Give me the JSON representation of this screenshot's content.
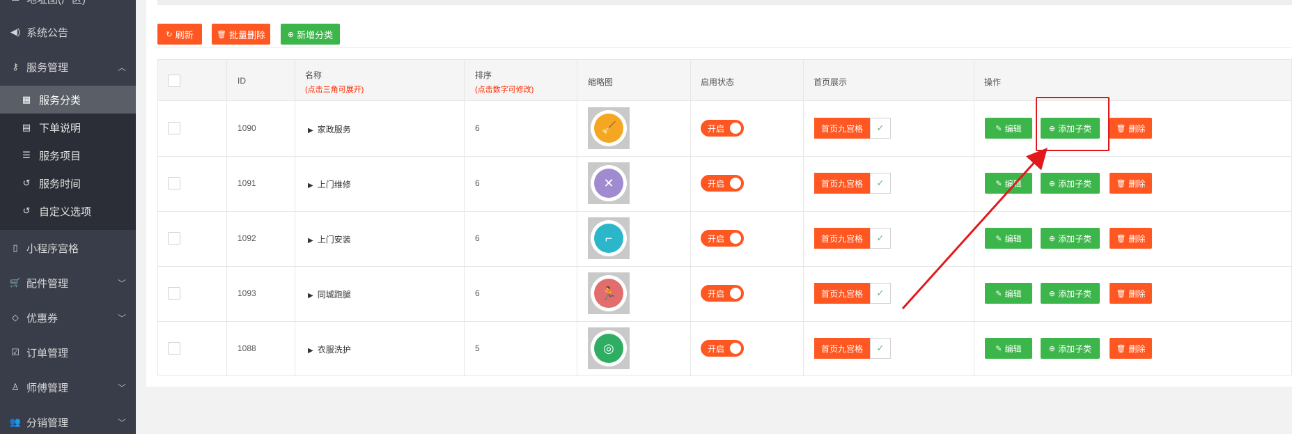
{
  "sidebar": {
    "top_partial": "地址图(厂区)",
    "items": [
      {
        "label": "系统公告",
        "icon": "volume-icon"
      },
      {
        "label": "服务管理",
        "icon": "key-icon",
        "chevron": "up"
      },
      {
        "label": "小程序宫格",
        "icon": "mobile-icon"
      },
      {
        "label": "配件管理",
        "icon": "cart-icon",
        "chevron": "down"
      },
      {
        "label": "优惠券",
        "icon": "diamond-icon",
        "chevron": "down"
      },
      {
        "label": "订单管理",
        "icon": "checkbox-icon"
      },
      {
        "label": "师傅管理",
        "icon": "user-icon",
        "chevron": "down"
      },
      {
        "label": "分销管理",
        "icon": "users-icon",
        "chevron": "down"
      }
    ],
    "sub_items": [
      {
        "label": "服务分类",
        "icon": "grid-icon",
        "active": true
      },
      {
        "label": "下单说明",
        "icon": "file-icon"
      },
      {
        "label": "服务项目",
        "icon": "list-icon"
      },
      {
        "label": "服务时间",
        "icon": "history-icon"
      },
      {
        "label": "自定义选项",
        "icon": "history-icon"
      }
    ]
  },
  "toolbar": {
    "refresh_label": "刷新",
    "batch_delete_label": "批量删除",
    "add_category_label": "新增分类"
  },
  "table": {
    "headers": {
      "id": "ID",
      "name": "名称",
      "name_hint": "(点击三角可展开)",
      "sort": "排序",
      "sort_hint": "(点击数字可修改)",
      "thumb": "缩略图",
      "status": "启用状态",
      "home": "首页展示",
      "actions": "操作"
    },
    "rows": [
      {
        "id": "1090",
        "name": "家政服务",
        "sort": "6",
        "status": "开启",
        "home": "首页九宫格",
        "icon_color": "#f5a623",
        "icon_glyph": "🧹"
      },
      {
        "id": "1091",
        "name": "上门维修",
        "sort": "6",
        "status": "开启",
        "home": "首页九宫格",
        "icon_color": "#a08bd1",
        "icon_glyph": "✕"
      },
      {
        "id": "1092",
        "name": "上门安装",
        "sort": "6",
        "status": "开启",
        "home": "首页九宫格",
        "icon_color": "#2bb6c9",
        "icon_glyph": "⌐"
      },
      {
        "id": "1093",
        "name": "同城跑腿",
        "sort": "6",
        "status": "开启",
        "home": "首页九宫格",
        "icon_color": "#e26d6d",
        "icon_glyph": "🏃"
      },
      {
        "id": "1088",
        "name": "衣服洗护",
        "sort": "5",
        "status": "开启",
        "home": "首页九宫格",
        "icon_color": "#2fae63",
        "icon_glyph": "◎"
      }
    ],
    "actions": {
      "edit": "编辑",
      "add_child": "添加子类",
      "delete": "删除"
    }
  },
  "colors": {
    "sidebar_bg": "#393d49",
    "orange": "#ff5722",
    "green": "#3cb54a",
    "annotation_red": "#e2191c"
  }
}
